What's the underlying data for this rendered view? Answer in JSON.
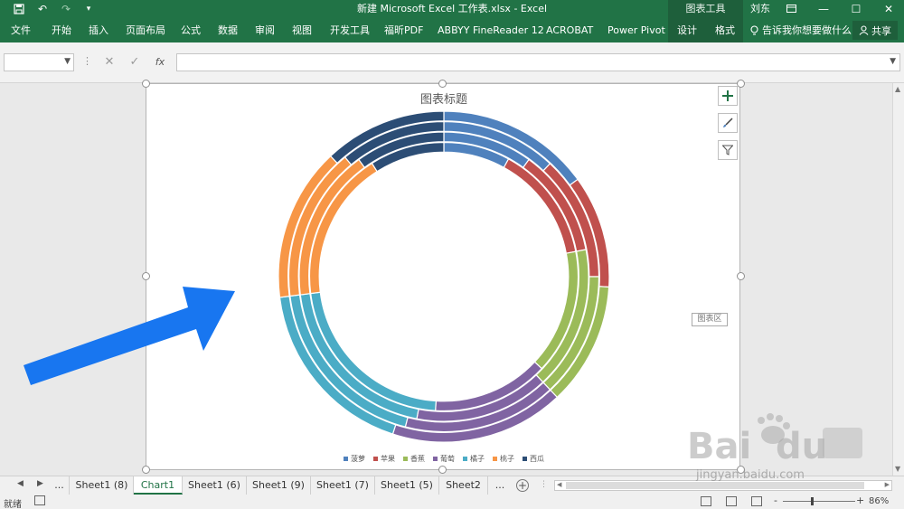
{
  "titlebar": {
    "title": "新建 Microsoft Excel 工作表.xlsx  -  Excel",
    "context_group": "图表工具",
    "user": "刘东",
    "save_icon": "save-icon",
    "undo_icon": "undo-icon",
    "redo_icon": "redo-icon"
  },
  "ribbon": {
    "tabs": [
      "文件",
      "开始",
      "插入",
      "页面布局",
      "公式",
      "数据",
      "审阅",
      "视图",
      "开发工具",
      "福昕PDF",
      "ABBYY FineReader 12",
      "ACROBAT",
      "Power Pivot",
      "设计",
      "格式"
    ],
    "tell_me": "告诉我你想要做什么",
    "share": "共享"
  },
  "formula_bar": {
    "fx_label": "fx",
    "name_box_value": "",
    "formula_value": ""
  },
  "chart": {
    "tooltip": "图表区"
  },
  "chart_data": {
    "type": "doughnut",
    "title": "图表标题",
    "categories": [
      "菠萝",
      "苹果",
      "香蕉",
      "葡萄",
      "橘子",
      "桃子",
      "西瓜"
    ],
    "colors": [
      "#4f81bd",
      "#c0504d",
      "#9bbb59",
      "#8064a2",
      "#4bacc6",
      "#f79646",
      "#2c4d75"
    ],
    "series": [
      {
        "values": [
          8,
          14,
          15,
          14,
          22,
          18,
          9
        ]
      },
      {
        "values": [
          10,
          12,
          16,
          15,
          20,
          17,
          10
        ]
      },
      {
        "values": [
          12,
          13,
          13,
          16,
          19,
          16,
          11
        ]
      },
      {
        "values": [
          15,
          11,
          12,
          17,
          18,
          15,
          12
        ]
      }
    ],
    "legend_position": "bottom"
  },
  "sheet_tabs": {
    "tabs": [
      "Sheet1 (8)",
      "Chart1",
      "Sheet1 (6)",
      "Sheet1 (9)",
      "Sheet1 (7)",
      "Sheet1 (5)",
      "Sheet2"
    ],
    "active": "Chart1",
    "ellipsis": "..."
  },
  "status_bar": {
    "ready": "就绪",
    "zoom": "86%",
    "minus": "-",
    "plus": "+"
  }
}
